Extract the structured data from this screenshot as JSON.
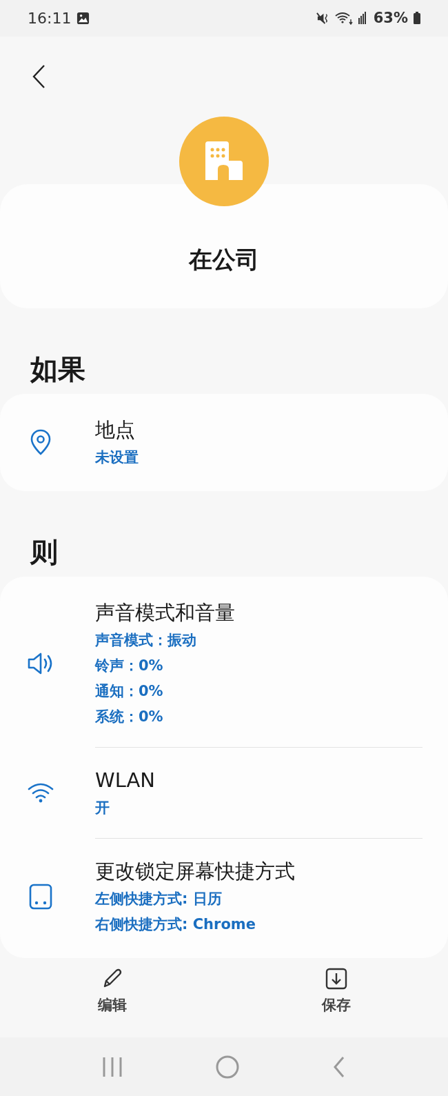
{
  "status_bar": {
    "time": "16:11",
    "battery": "63%"
  },
  "routine": {
    "name": "在公司"
  },
  "if_section": {
    "heading": "如果",
    "items": [
      {
        "kind": "location",
        "title": "地点",
        "details": [
          "未设置"
        ]
      }
    ]
  },
  "then_section": {
    "heading": "则",
    "items": [
      {
        "kind": "sound",
        "title": "声音模式和音量",
        "details": [
          "声音模式：振动",
          "铃声：0%",
          "通知：0%",
          "系统：0%"
        ]
      },
      {
        "kind": "wifi",
        "title": "WLAN",
        "details": [
          "开"
        ]
      },
      {
        "kind": "lockscreen",
        "title": "更改锁定屏幕快捷方式",
        "details": [
          "左侧快捷方式: 日历",
          "右侧快捷方式: Chrome"
        ]
      }
    ]
  },
  "bottom_actions": [
    {
      "kind": "edit",
      "label": "编辑"
    },
    {
      "kind": "save",
      "label": "保存"
    }
  ]
}
